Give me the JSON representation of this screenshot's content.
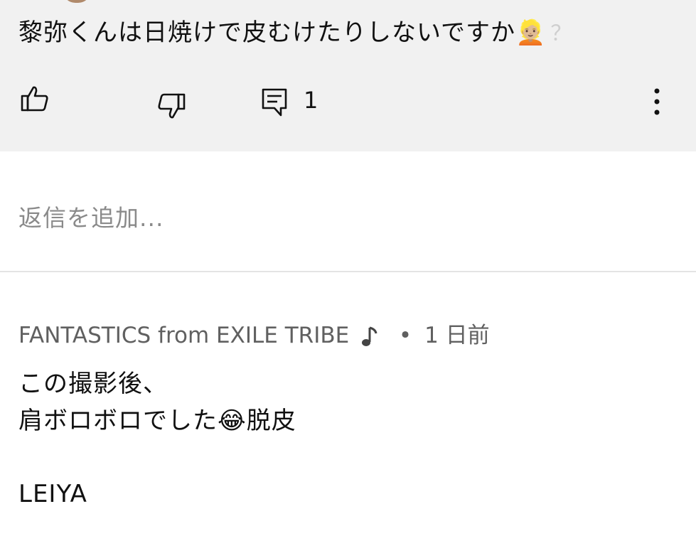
{
  "parent_comment": {
    "text": "黎弥くんは日焼けで皮むけたりしないですか👱🏼",
    "trailing": "？",
    "reply_count": "1"
  },
  "reply_placeholder": "返信を追加...",
  "reply": {
    "author": "FANTASTICS from EXILE TRIBE",
    "separator": "•",
    "time": "1 日前",
    "lines": [
      "この撮影後、",
      "肩ボロボロでした😂脱皮",
      "LEIYA"
    ]
  },
  "icons": [
    "thumbs-up-icon",
    "thumbs-down-icon",
    "reply-icon",
    "more-icon",
    "music-note-icon"
  ]
}
